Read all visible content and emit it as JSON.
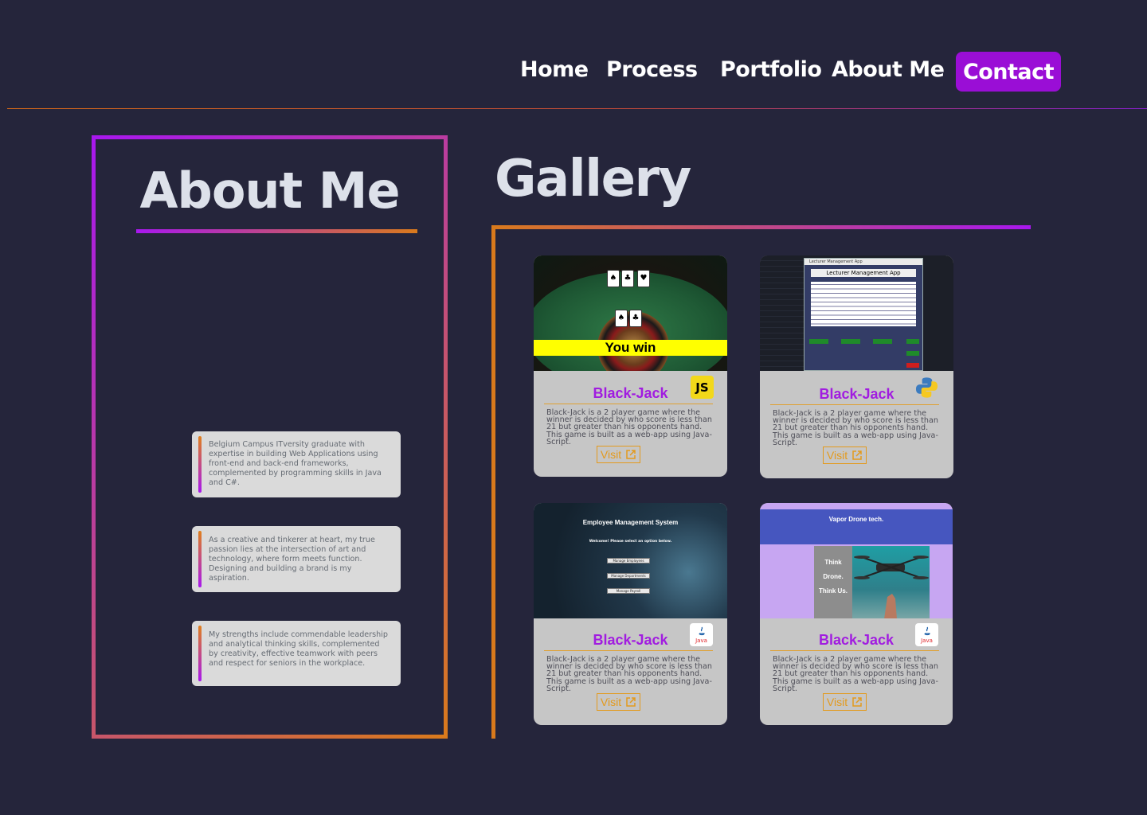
{
  "nav": {
    "items": [
      "Home",
      "Process",
      "Portfolio",
      "About Me"
    ],
    "contact": "Contact"
  },
  "about": {
    "title": "About Me",
    "cards": [
      "Belgium Campus ITversity graduate with expertise in building Web Applications using front-end and back-end frameworks, complemented by programming skills in Java and C#.",
      "As a creative and tinkerer at heart, my true passion lies at the intersection of art and technology, where form meets function. Designing and building a brand is my aspiration.",
      "My strengths include commendable leadership and analytical thinking skills, complemented by creativity, effective teamwork with peers and respect for seniors in the workplace."
    ]
  },
  "gallery": {
    "title": "Gallery",
    "projects": [
      {
        "title": "Black-Jack",
        "desc": "Black-Jack is a 2 player game where the winner is decided by who score is less than 21 but greater than his opponents hand. This game is built as a web-app using Java-Script.",
        "visit": "Visit",
        "badge": "JS",
        "badge_icon": "javascript-icon"
      },
      {
        "title": "Black-Jack",
        "desc": "Black-Jack is a 2 player game where the winner is decided by who score is less than 21 but greater than his opponents hand. This game is built as a web-app using Java-Script.",
        "visit": "Visit",
        "badge": "",
        "badge_icon": "python-icon"
      },
      {
        "title": "Black-Jack",
        "desc": "Black-Jack is a 2 player game where the winner is decided by who score is less than 21 but greater than his opponents hand. This game is built as a web-app using Java-Script.",
        "visit": "Visit",
        "badge": "Java",
        "badge_icon": "java-icon"
      },
      {
        "title": "Black-Jack",
        "desc": "Black-Jack is a 2 player game where the winner is decided by who score is less than 21 but greater than his opponents hand. This game is built as a web-app using Java-Script.",
        "visit": "Visit",
        "badge": "Java",
        "badge_icon": "java-icon"
      }
    ],
    "screens": {
      "blackjack_result": "You win",
      "lecturer_window": "Lecturer Management App",
      "lecturer_header": "Lecturer Management App",
      "employee_title": "Employee Management System",
      "employee_prompt": "Welcome! Please select an option below.",
      "employee_buttons": [
        "Manage Employees",
        "Manage Departments",
        "Manage Payroll"
      ],
      "drone_brand": "Vapor Drone tech.",
      "drone_slogan": [
        "Think",
        "Drone.",
        "Think Us."
      ]
    }
  },
  "colors": {
    "background": "#25253b",
    "accent_purple": "#9a0ed6",
    "accent_orange": "#d97a1c",
    "card_title": "#a11ce0"
  }
}
